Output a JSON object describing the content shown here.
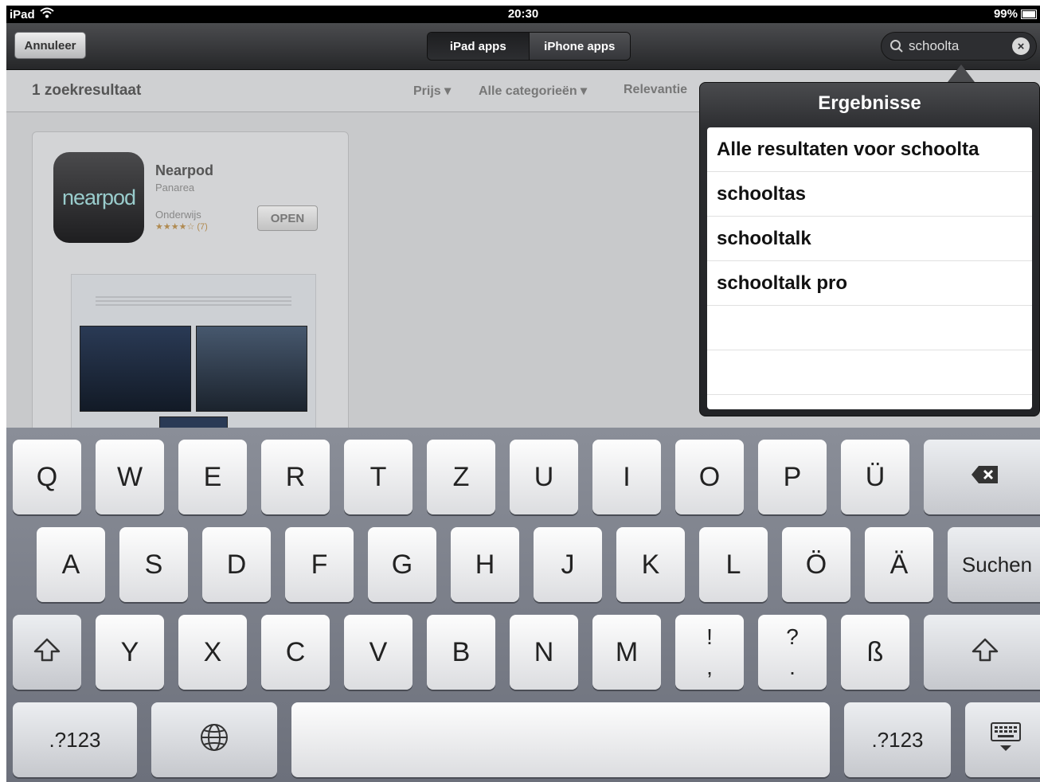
{
  "status_bar": {
    "device": "iPad",
    "time": "20:30",
    "battery": "99%"
  },
  "nav": {
    "cancel_label": "Annuleer",
    "segments": [
      "iPad apps",
      "iPhone apps"
    ],
    "search_value": "schoolta"
  },
  "filter_bar": {
    "result_count": "1 zoekresultaat",
    "filters": [
      "Prijs ▾",
      "Alle categorieën ▾",
      "Relevantie"
    ]
  },
  "result": {
    "app_name": "Nearpod",
    "icon_text": "nearpod",
    "developer": "Panarea",
    "category": "Onderwijs",
    "rating": "★★★★☆ (7)",
    "action_label": "OPEN"
  },
  "popover": {
    "title": "Ergebnisse",
    "rows": [
      "Alle resultaten voor schoolta",
      "schooltas",
      "schooltalk",
      "schooltalk pro",
      "",
      ""
    ]
  },
  "keyboard": {
    "row1": [
      "Q",
      "W",
      "E",
      "R",
      "T",
      "Z",
      "U",
      "I",
      "O",
      "P",
      "Ü"
    ],
    "row2": [
      "A",
      "S",
      "D",
      "F",
      "G",
      "H",
      "J",
      "K",
      "L",
      "Ö",
      "Ä"
    ],
    "row2_action": "Suchen",
    "row3": [
      "Y",
      "X",
      "C",
      "V",
      "B",
      "N",
      "M"
    ],
    "row3_punct": [
      [
        "!",
        ","
      ],
      [
        "?",
        "."
      ]
    ],
    "row3_last": "ß",
    "numbers_label": ".?123"
  }
}
